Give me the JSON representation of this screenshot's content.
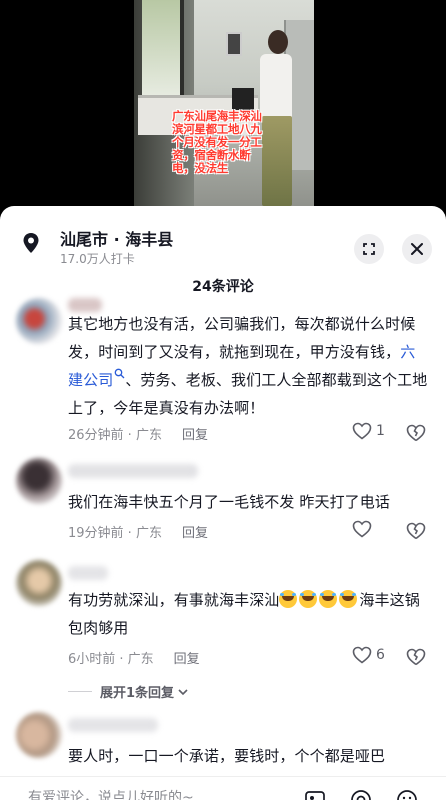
{
  "video": {
    "caption": "广东汕尾海丰深汕滨河星都工地八九个月没有发一分工资，宿舍断水断电，没法生"
  },
  "location": {
    "title": "汕尾市 · 海丰县",
    "subtitle": "17.0万人打卡"
  },
  "comments_header": {
    "count_label": "24条评论"
  },
  "comments": [
    {
      "text_before": "其它地方也没有活，公司骗我们，每次都说什么时候发，时间到了又没有，就拖到现在，甲方没有钱，",
      "link": "六建公司",
      "text_after": "、劳务、老板、我们工人全部都载到这个工地上了，今年是真没有办法啊！",
      "meta": "26分钟前 · 广东",
      "reply": "回复",
      "likes": "1"
    },
    {
      "text": "我们在海丰快五个月了一毛钱不发 昨天打了电话",
      "meta": "19分钟前 · 广东",
      "reply": "回复",
      "likes": ""
    },
    {
      "text_before": "有功劳就深汕，有事就海丰深汕",
      "text_after": "海丰这锅包肉够用",
      "meta": "6小时前 · 广东",
      "reply": "回复",
      "likes": "6",
      "expand": "展开1条回复"
    },
    {
      "text": "要人时，一口一个承诺，要钱时，个个都是哑巴"
    }
  ],
  "input": {
    "placeholder": "有爱评论，说点儿好听的~"
  },
  "icons": {
    "location": "location-pin-icon",
    "collapse": "collapse-icon",
    "close": "close-icon",
    "like": "heart-icon",
    "dislike": "broken-heart-icon",
    "image": "image-icon",
    "mention": "at-icon",
    "emoji": "emoji-icon"
  }
}
